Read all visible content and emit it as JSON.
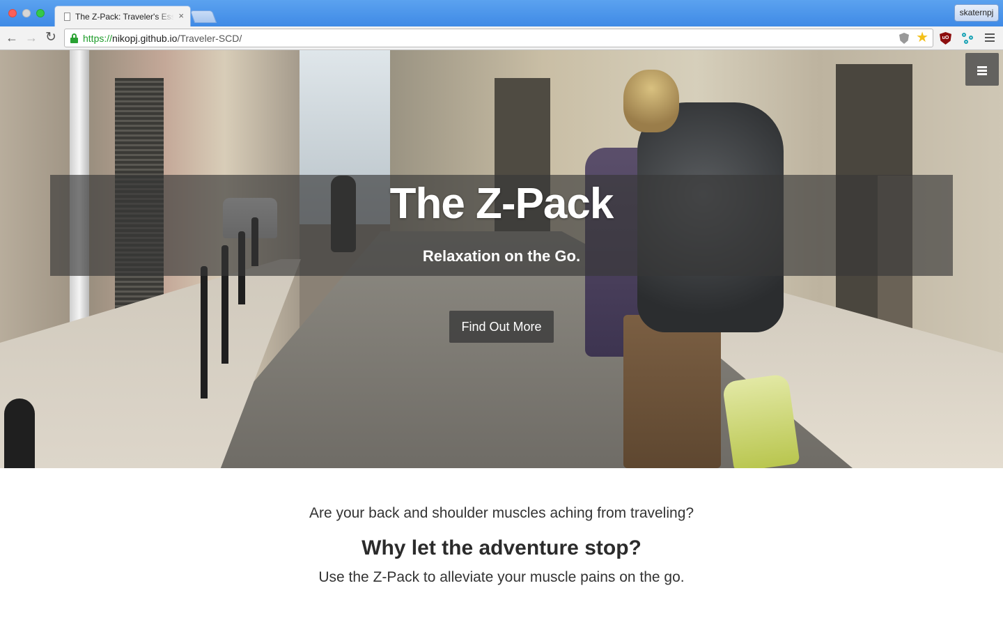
{
  "browser": {
    "tab": {
      "title": "The Z-Pack: Traveler's Essentials",
      "close_icon": "×"
    },
    "profile_name": "skaternpj",
    "address": {
      "scheme": "https://",
      "host": "nikopj.github.io",
      "path": "/Traveler-SCD/"
    },
    "extensions": [
      "shield-icon",
      "star-icon",
      "ublock-icon",
      "network-icon"
    ],
    "nav": {
      "back": "←",
      "forward": "→",
      "reload": "↻"
    }
  },
  "hero": {
    "title": "The Z-Pack",
    "subtitle": "Relaxation on the Go.",
    "cta_label": "Find Out More"
  },
  "intro": {
    "question": "Are your back and shoulder muscles aching from traveling?",
    "heading": "Why let the adventure stop?",
    "text": "Use the Z-Pack to alleviate your muscle pains on the go."
  },
  "colors": {
    "overlay": "#373737",
    "text_dark": "#333333",
    "url_secure": "#1e9c2a",
    "tabstrip": "#3f8ae6"
  }
}
